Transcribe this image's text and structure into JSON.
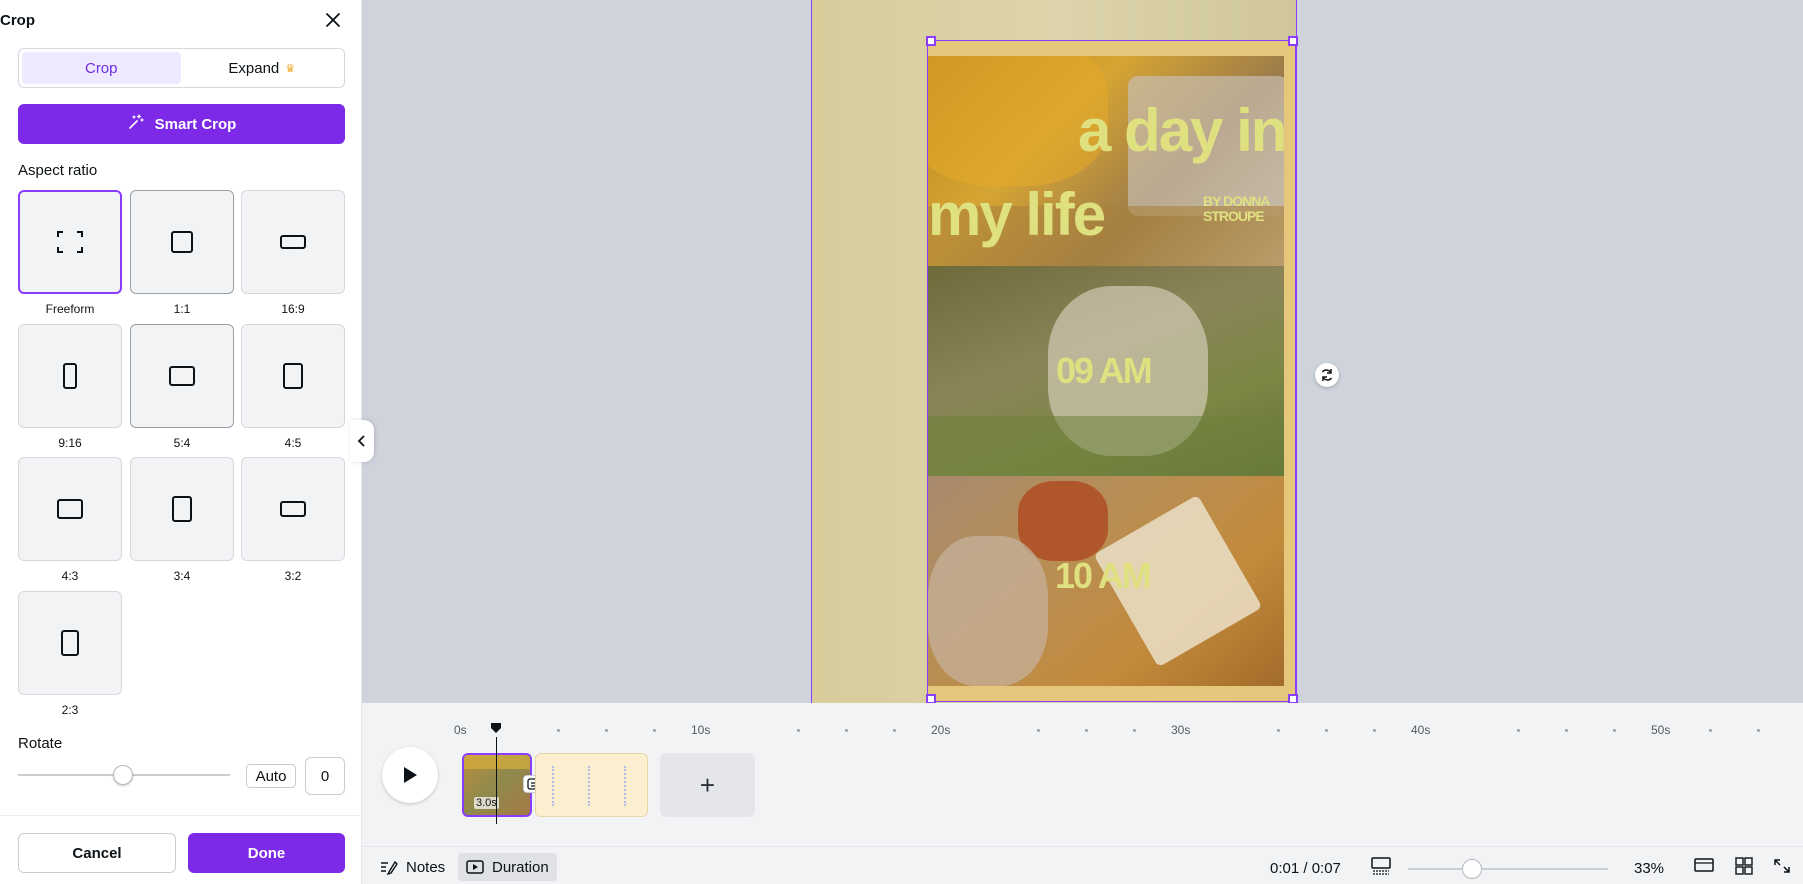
{
  "panel": {
    "title": "Crop",
    "tabs": [
      {
        "label": "Crop",
        "active": true
      },
      {
        "label": "Expand",
        "active": false
      }
    ],
    "smart_crop_label": "Smart Crop",
    "aspect_ratio_label": "Aspect ratio",
    "ratios": [
      {
        "label": "Freeform",
        "selected": true
      },
      {
        "label": "1:1"
      },
      {
        "label": "16:9"
      },
      {
        "label": "9:16"
      },
      {
        "label": "5:4"
      },
      {
        "label": "4:5"
      },
      {
        "label": "4:3"
      },
      {
        "label": "3:4"
      },
      {
        "label": "3:2"
      },
      {
        "label": "2:3"
      }
    ],
    "rotate_label": "Rotate",
    "rotate_auto_label": "Auto",
    "rotate_value": "0",
    "cancel_label": "Cancel",
    "done_label": "Done"
  },
  "design": {
    "headline_1": "a day in",
    "headline_2": "my life",
    "byline_1": "BY DONNA",
    "byline_2": "STROUPE",
    "time_1": "09 AM",
    "time_2": "10 AM"
  },
  "timeline": {
    "ticks": [
      "0s",
      "10s",
      "20s",
      "30s",
      "40s",
      "50s"
    ],
    "clip_1_duration": "3.0s",
    "add_clip_label": "+"
  },
  "bottombar": {
    "notes_label": "Notes",
    "duration_label": "Duration",
    "time": "0:01 / 0:07",
    "zoom": "33%"
  },
  "colors": {
    "accent": "#7d2ae8",
    "overlay_text": "#dfe07f",
    "canvas_bg": "#cfd3dc"
  }
}
